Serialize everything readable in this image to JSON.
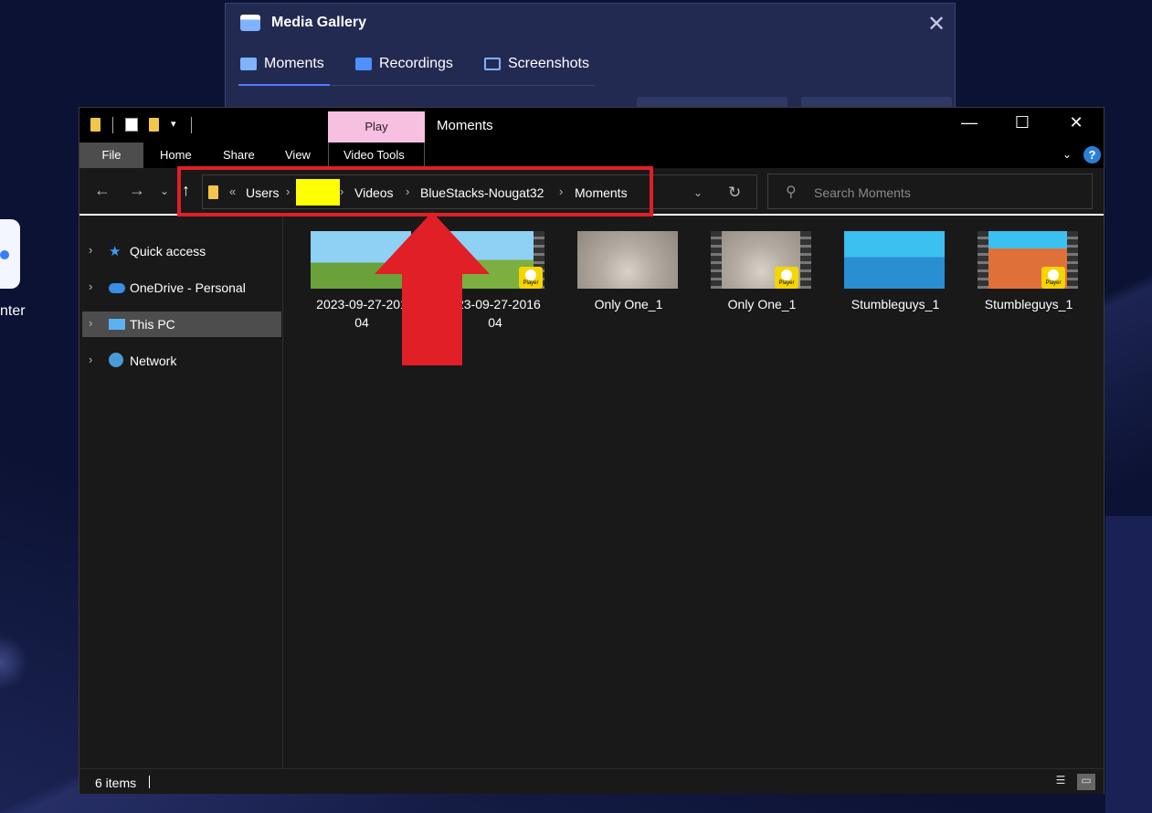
{
  "desktop": {
    "icon_label": "nter"
  },
  "media_gallery": {
    "title": "Media Gallery",
    "tabs": [
      {
        "label": "Moments"
      },
      {
        "label": "Recordings"
      },
      {
        "label": "Screenshots"
      }
    ]
  },
  "explorer": {
    "context_tab": "Play",
    "window_title": "Moments",
    "ribbon_tabs": {
      "file": "File",
      "home": "Home",
      "share": "Share",
      "view": "View",
      "video_tools": "Video Tools"
    },
    "address": {
      "overflow": "«",
      "crumbs": [
        "Users",
        "Videos",
        "BlueStacks-Nougat32",
        "Moments"
      ]
    },
    "search_placeholder": "Search Moments",
    "sidebar": [
      {
        "label": "Quick access",
        "icon": "star-icon"
      },
      {
        "label": "OneDrive - Personal",
        "icon": "cloud-icon"
      },
      {
        "label": "This PC",
        "icon": "computer-icon",
        "selected": true
      },
      {
        "label": "Network",
        "icon": "network-icon"
      }
    ],
    "files": [
      {
        "line1": "2023-09-27-201",
        "line2": "04",
        "video": false
      },
      {
        "line1": "023-09-27-2016",
        "line2": "04",
        "video": true
      },
      {
        "line1": "Only One_1",
        "line2": "",
        "video": false
      },
      {
        "line1": "Only One_1",
        "line2": "",
        "video": true
      },
      {
        "line1": "Stumbleguys_1",
        "line2": "",
        "video": false
      },
      {
        "line1": "Stumbleguys_1",
        "line2": "",
        "video": true
      }
    ],
    "player_badge": "Player",
    "status": "6 items"
  },
  "colors": {
    "highlight": "#e01f26",
    "redaction": "#ffff00",
    "play_tab": "#f7bfe0"
  }
}
